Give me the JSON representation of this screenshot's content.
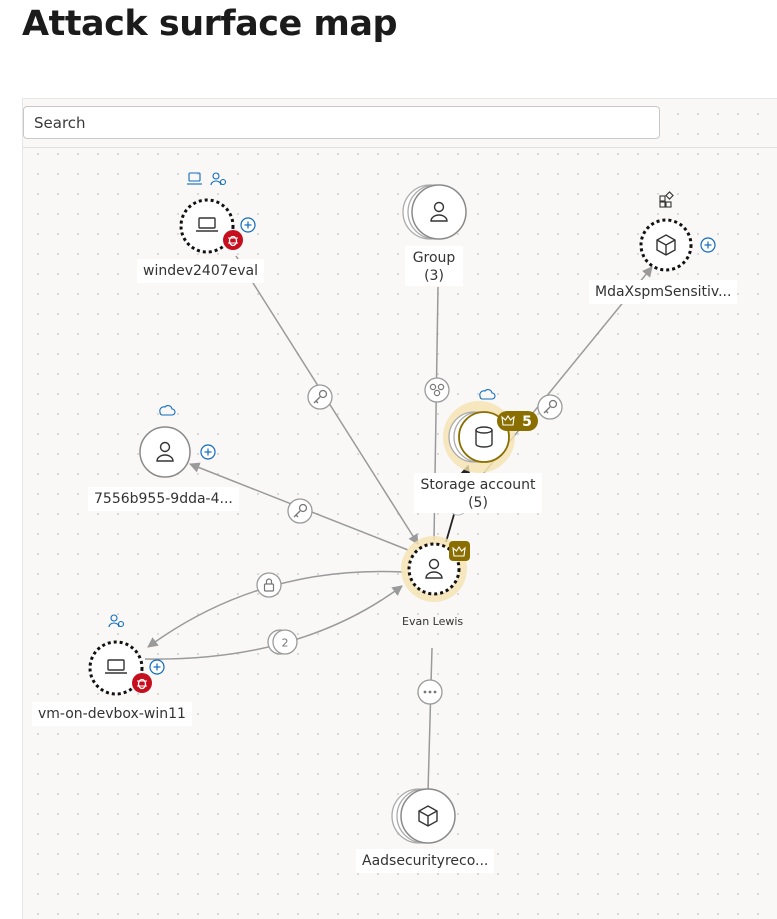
{
  "page": {
    "title": "Attack surface map"
  },
  "search": {
    "placeholder": "Search"
  },
  "nodes": {
    "windev": {
      "label": "windev2407eval"
    },
    "group": {
      "label": "Group",
      "count": "(3)"
    },
    "mda": {
      "label": "MdaXspmSensitiv..."
    },
    "user7556": {
      "label": "7556b955-9dda-4..."
    },
    "storage": {
      "label": "Storage account",
      "count": "(5)",
      "critical_badge": "5"
    },
    "evan": {
      "label": "Evan Lewis"
    },
    "vm": {
      "label": "vm-on-devbox-win11"
    },
    "aad": {
      "label": "Aadsecurityreco..."
    }
  },
  "edges": {
    "vm_to_evan_count": "2"
  },
  "colors": {
    "edge": "#9a9a9a",
    "accent": "#0f6cbd",
    "vulnerability": "#c50f1f",
    "critical": "#8a6f00",
    "highlight": "#f5e2b0"
  }
}
